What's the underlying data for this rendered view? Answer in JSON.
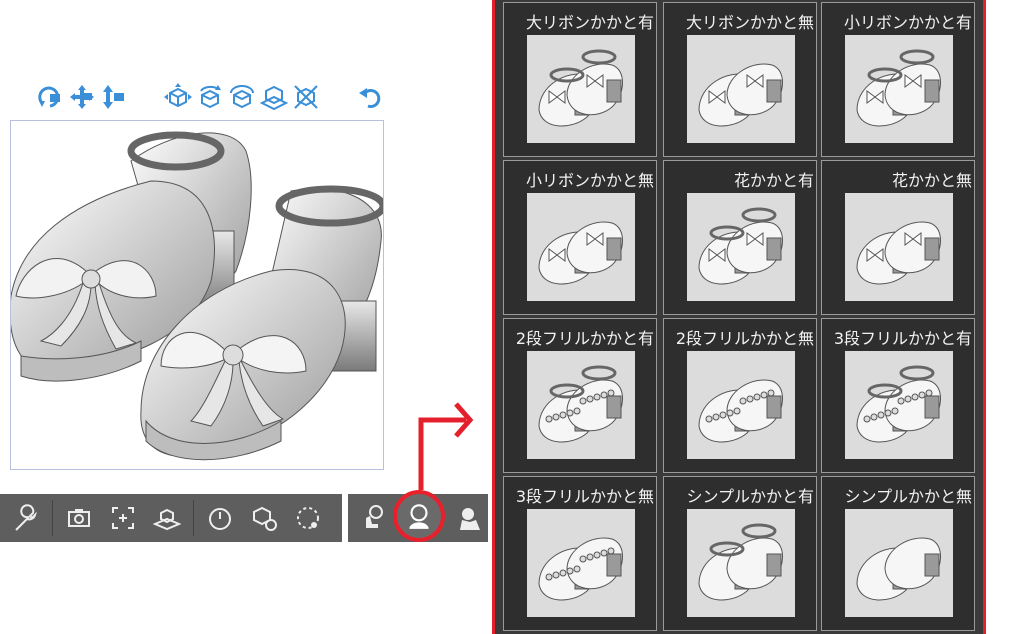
{
  "colors": {
    "accent_blue": "#3a8fd8",
    "highlight_red": "#e4202c",
    "panel_bg": "#3a3a3a",
    "toolbar_bg": "#5e5e5e"
  },
  "top_toolbar": {
    "icons": [
      "camera-rotate-icon",
      "camera-pan-icon",
      "camera-dolly-icon",
      "object-move-icon",
      "object-rotate-icon",
      "object-rotate-horizontal-icon",
      "object-move-plane-icon",
      "object-reset-axis-icon",
      "undo-icon"
    ]
  },
  "bottom_toolbar": {
    "icons": [
      "wrench-icon",
      "camera-view-icon",
      "frame-fit-icon",
      "ground-icon",
      "timer-icon",
      "object-list-icon",
      "rotate-reset-icon",
      "material-icon",
      "preset-material-icon",
      "hand-pose-icon"
    ]
  },
  "materials": [
    {
      "label": "大リボンかかと有",
      "variant": "big-ribbon-strap"
    },
    {
      "label": "大リボンかかと無",
      "variant": "big-ribbon"
    },
    {
      "label": "小リボンかかと有",
      "variant": "small-ribbon-strap"
    },
    {
      "label": "小リボンかかと無",
      "variant": "small-ribbon"
    },
    {
      "label": "花かかと有",
      "variant": "flower-strap"
    },
    {
      "label": "花かかと無",
      "variant": "flower"
    },
    {
      "label": "2段フリルかかと有",
      "variant": "frill2-strap"
    },
    {
      "label": "2段フリルかかと無",
      "variant": "frill2"
    },
    {
      "label": "3段フリルかかと有",
      "variant": "frill3-strap"
    },
    {
      "label": "3段フリルかかと無",
      "variant": "frill3"
    },
    {
      "label": "シンプルかかと有",
      "variant": "simple-strap"
    },
    {
      "label": "シンプルかかと無",
      "variant": "simple"
    }
  ]
}
